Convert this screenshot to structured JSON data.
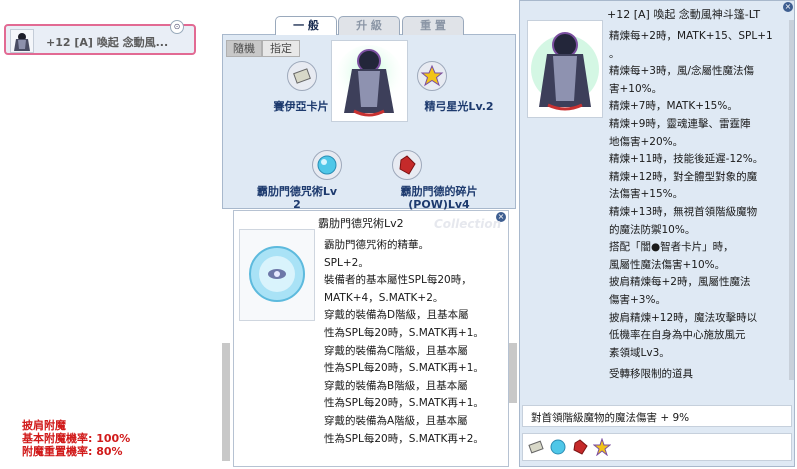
{
  "equip_slot": {
    "item_name": "+12 [A] 喚起 念動風..."
  },
  "window": {
    "tabs": [
      "一 般",
      "升 級",
      "重 置"
    ],
    "subtabs": [
      "隨機",
      "指定"
    ],
    "slots": {
      "top_left": "賽伊亞卡片",
      "top_right": "精弓星光Lv.2",
      "bottom_left": "霸肋門德咒術Lv\n2",
      "bottom_right": "霸肋門德的碎片\n(POW)Lv4"
    }
  },
  "tooltip": {
    "title": "霸肋門德咒術Lv2",
    "lines": [
      "霸肋門德咒術的精華。",
      "SPL+2。",
      "裝備者的基本屬性SPL每20時，",
      "MATK+4，S.MATK+2。",
      "穿戴的裝備為D階級，且基本屬",
      "性為SPL每20時，S.MATK再+1。",
      "穿戴的裝備為C階級，且基本屬",
      "性為SPL每20時，S.MATK再+1。",
      "穿戴的裝備為B階級，且基本屬",
      "性為SPL每20時，S.MATK再+1。",
      "穿戴的裝備為A階級，且基本屬",
      "性為SPL每20時，S.MATK再+2。"
    ]
  },
  "item_info": {
    "title": "+12 [A] 喚起 念動風神斗篷-LT",
    "lines": [
      "精煉每+2時，MATK+15、SPL+1",
      "。",
      "精煉每+3時，風/念屬性魔法傷",
      "害+10%。",
      "精煉+7時，MATK+15%。",
      "精煉+9時，靈魂連擊、雷霆陣",
      "地傷害+20%。",
      "精煉+11時，技能後延遲-12%。",
      "精煉+12時，對全體型對象的魔",
      "法傷害+15%。",
      "精煉+13時，無視首領階級魔物",
      "的魔法防禦10%。",
      "搭配「闇●智者卡片」時，",
      "風屬性魔法傷害+10%。",
      "披肩精煉每+2時，風屬性魔法",
      "傷害+3%。",
      "披肩精煉+12時，魔法攻擊時以",
      "低機率在自身為中心施放風元",
      "素領域Lv3。"
    ],
    "footer_partial": "受轉移限制的道具",
    "option_line": "對首領階級魔物的魔法傷害 + 9%"
  },
  "bottom_left": {
    "heading": "披肩附魔",
    "lines": [
      "基本附魔機率: 100%",
      "附魔重置機率: 80%"
    ]
  },
  "watermark": "Collection",
  "colors": {
    "title_text": "#1d3a6e",
    "panel_border": "#a8b8cc",
    "panel_bg": "#dfe9f4",
    "red_text": "#d11a1a"
  }
}
